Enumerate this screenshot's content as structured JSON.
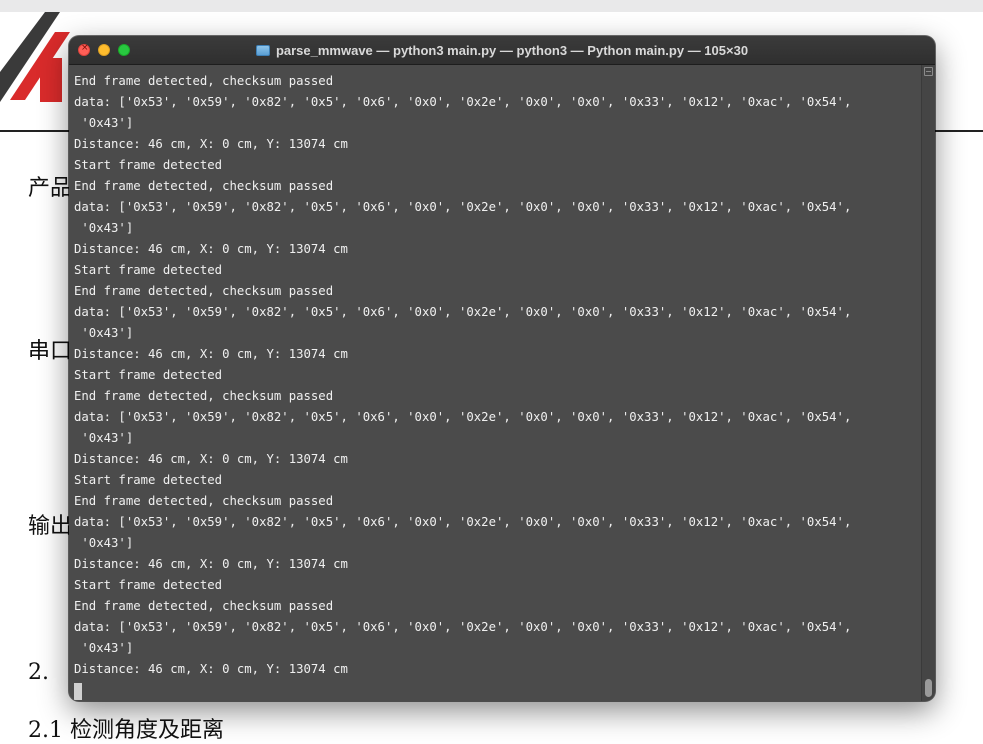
{
  "background": {
    "headings": [
      "产品",
      "串口",
      "输出",
      "2.",
      "2.1 检测角度及距离"
    ]
  },
  "window": {
    "title": "parse_mmwave — python3 main.py — python3 — Python main.py — 105×30"
  },
  "terminal": {
    "lines": [
      "End frame detected, checksum passed",
      "data: ['0x53', '0x59', '0x82', '0x5', '0x6', '0x0', '0x2e', '0x0', '0x0', '0x33', '0x12', '0xac', '0x54',",
      " '0x43']",
      "Distance: 46 cm, X: 0 cm, Y: 13074 cm",
      "Start frame detected",
      "End frame detected, checksum passed",
      "data: ['0x53', '0x59', '0x82', '0x5', '0x6', '0x0', '0x2e', '0x0', '0x0', '0x33', '0x12', '0xac', '0x54',",
      " '0x43']",
      "Distance: 46 cm, X: 0 cm, Y: 13074 cm",
      "Start frame detected",
      "End frame detected, checksum passed",
      "data: ['0x53', '0x59', '0x82', '0x5', '0x6', '0x0', '0x2e', '0x0', '0x0', '0x33', '0x12', '0xac', '0x54',",
      " '0x43']",
      "Distance: 46 cm, X: 0 cm, Y: 13074 cm",
      "Start frame detected",
      "End frame detected, checksum passed",
      "data: ['0x53', '0x59', '0x82', '0x5', '0x6', '0x0', '0x2e', '0x0', '0x0', '0x33', '0x12', '0xac', '0x54',",
      " '0x43']",
      "Distance: 46 cm, X: 0 cm, Y: 13074 cm",
      "Start frame detected",
      "End frame detected, checksum passed",
      "data: ['0x53', '0x59', '0x82', '0x5', '0x6', '0x0', '0x2e', '0x0', '0x0', '0x33', '0x12', '0xac', '0x54',",
      " '0x43']",
      "Distance: 46 cm, X: 0 cm, Y: 13074 cm",
      "Start frame detected",
      "End frame detected, checksum passed",
      "data: ['0x53', '0x59', '0x82', '0x5', '0x6', '0x0', '0x2e', '0x0', '0x0', '0x33', '0x12', '0xac', '0x54',",
      " '0x43']",
      "Distance: 46 cm, X: 0 cm, Y: 13074 cm"
    ]
  },
  "colors": {
    "terminal_bg": "#4b4b4b",
    "terminal_text": "#f0f0f0",
    "close": "#ff5f57",
    "minimize": "#febc2e",
    "maximize": "#28c840",
    "logo_red": "#d92b2b"
  },
  "icons": {
    "close": "close-icon",
    "folder": "folder-icon",
    "cursor": "cursor-block"
  }
}
